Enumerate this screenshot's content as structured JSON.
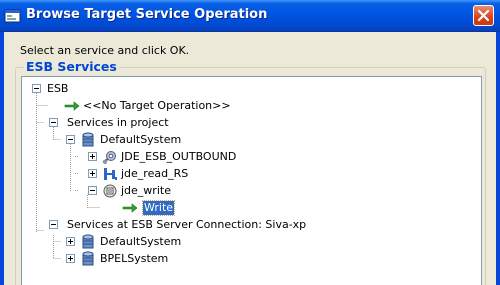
{
  "window": {
    "title": "Browse Target Service Operation"
  },
  "dialog": {
    "instruction": "Select an service and click OK.",
    "group_label": "ESB Services"
  },
  "tree": {
    "root": "ESB",
    "no_target": "<<No Target Operation>>",
    "services_in_project": "Services in project",
    "default_system": "DefaultSystem",
    "jde_esb_outbound": "JDE_ESB_OUTBOUND",
    "jde_read_rs": "jde_read_RS",
    "jde_write": "jde_write",
    "write_op": "Write",
    "services_at_server": "Services at ESB Server Connection: Siva-xp",
    "server_default_system": "DefaultSystem",
    "bpel_system": "BPELSystem"
  },
  "colors": {
    "titlebar": "#0054e3",
    "dialog_bg": "#ece9d8",
    "group_label": "#0046d5",
    "selection": "#316ac5",
    "close_button": "#d5421c"
  }
}
